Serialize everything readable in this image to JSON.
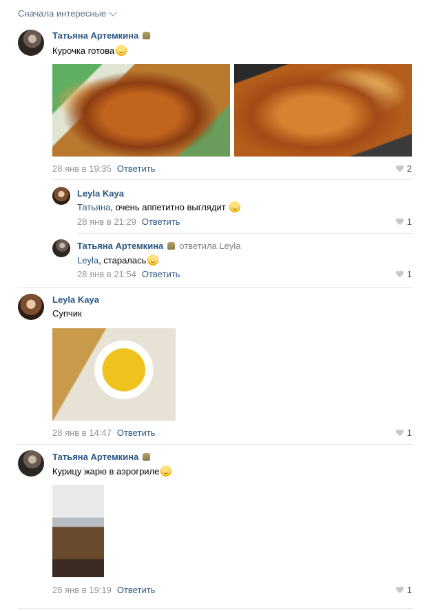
{
  "sort": {
    "label": "Сначала интересные"
  },
  "comments": [
    {
      "author": "Татьяна Артемкина",
      "text": "Курочка готова",
      "date": "28 янв в 19:35",
      "reply_label": "Ответить",
      "likes": "2",
      "replies": [
        {
          "author": "Leyla Kaya",
          "mention": "Татьяна",
          "text": ", очень аппетитно выглядит ",
          "date": "28 янв в 21:29",
          "reply_label": "Ответить",
          "likes": "1"
        },
        {
          "author": "Татьяна Артемкина",
          "replied_to": "ответила Leyla",
          "mention": "Leyla",
          "text": ", старалась",
          "date": "28 янв в 21:54",
          "reply_label": "Ответить",
          "likes": "1"
        }
      ]
    },
    {
      "author": "Leyla Kaya",
      "text": "Супчик",
      "date": "28 янв в 14:47",
      "reply_label": "Ответить",
      "likes": "1"
    },
    {
      "author": "Татьяна Артемкина",
      "text": "Курицу жарю в аэрогриле",
      "date": "28 янв в 19:19",
      "reply_label": "Ответить",
      "likes": "1"
    }
  ],
  "icons": {
    "verified": "badge-icon",
    "like": "heart-icon",
    "emoji": "smile-emoji",
    "sort": "chevron-down-icon"
  },
  "colors": {
    "link": "#2a5885",
    "meta": "#939393",
    "divider": "#e7e8ec"
  }
}
